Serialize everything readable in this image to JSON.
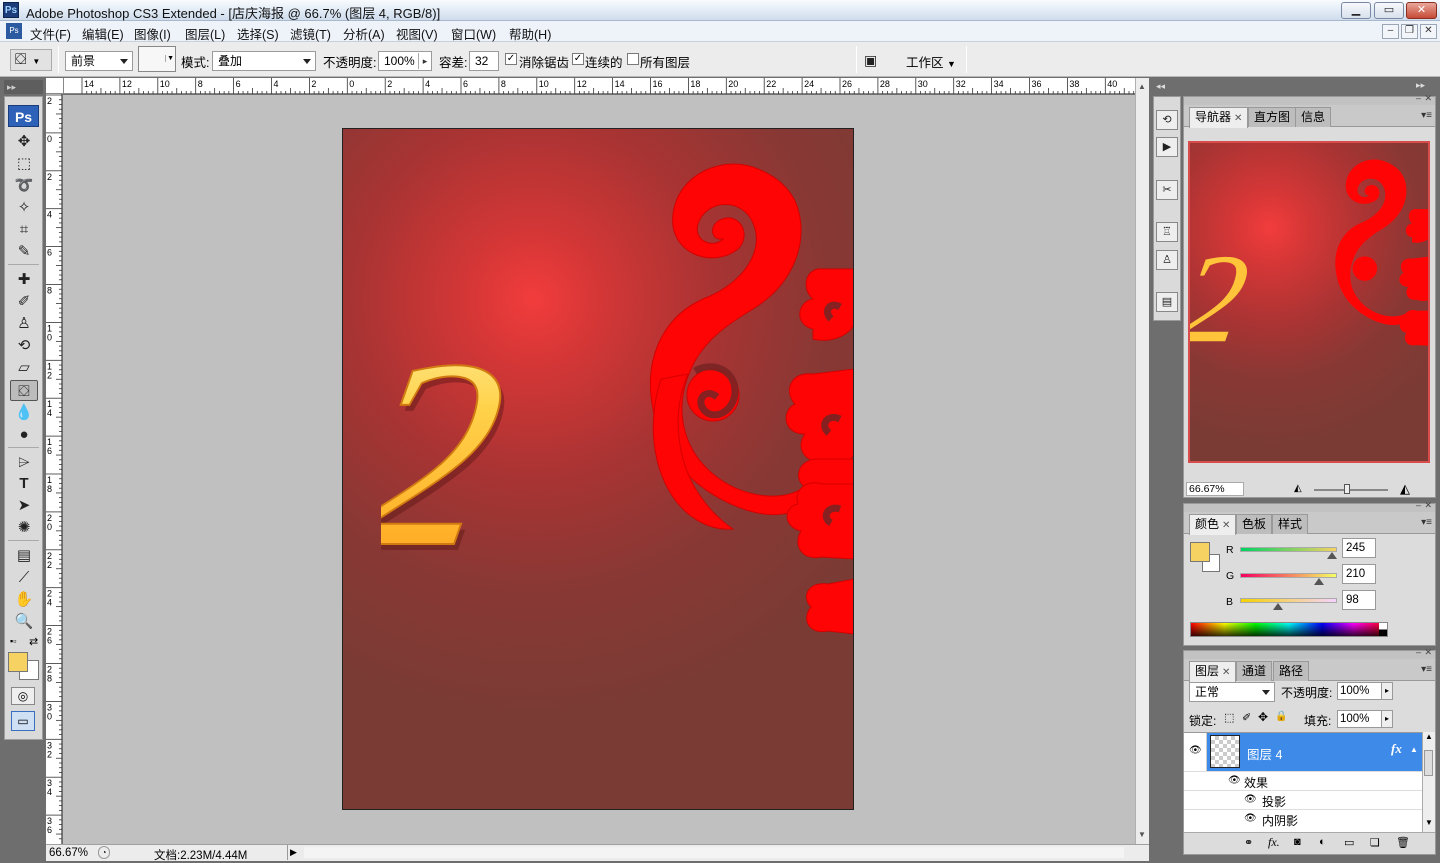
{
  "window": {
    "title": "Adobe Photoshop CS3 Extended - [店庆海报 @ 66.7% (图层 4, RGB/8)]",
    "ps_logo": "Ps",
    "controls": [
      "▁",
      "▭",
      "✕"
    ]
  },
  "menu": {
    "items": [
      "文件(F)",
      "编辑(E)",
      "图像(I)",
      "图层(L)",
      "选择(S)",
      "滤镜(T)",
      "分析(A)",
      "视图(V)",
      "窗口(W)",
      "帮助(H)"
    ],
    "doc_controls": [
      "‒",
      "❐",
      "✕"
    ]
  },
  "options": {
    "fill_source": "前景",
    "mode_label": "模式:",
    "mode_value": "叠加",
    "opacity_label": "不透明度:",
    "opacity_value": "100%",
    "tolerance_label": "容差:",
    "tolerance_value": "32",
    "antialias_label": "消除锯齿",
    "antialias_checked": true,
    "contiguous_label": "连续的",
    "contiguous_checked": true,
    "all_layers_label": "所有图层",
    "all_layers_checked": false,
    "workspace_label": "工作区"
  },
  "ruler": {
    "top_labels": [
      "14",
      "12",
      "10",
      "8",
      "6",
      "4",
      "2",
      "0",
      "2",
      "4",
      "6",
      "8",
      "10",
      "12",
      "14",
      "16",
      "18",
      "20",
      "22",
      "24",
      "26",
      "28",
      "30",
      "32",
      "34",
      "36",
      "38",
      "40"
    ],
    "left_labels": [
      "2",
      "0",
      "2",
      "4",
      "6",
      "8",
      "10",
      "12",
      "14",
      "16",
      "18",
      "20",
      "22",
      "24",
      "26",
      "28",
      "30",
      "32",
      "34",
      "36"
    ]
  },
  "toolbox": {
    "logo": "Ps",
    "foreground_color": "#f5d262",
    "background_color": "#ffffff"
  },
  "document": {
    "numeral": "2"
  },
  "status": {
    "zoom": "66.67%",
    "doc_size": "文档:2.23M/4.44M"
  },
  "navigator": {
    "tabs": [
      "导航器",
      "直方图",
      "信息"
    ],
    "zoom": "66.67%"
  },
  "color_panel": {
    "tabs": [
      "颜色",
      "色板",
      "样式"
    ],
    "r_label": "R",
    "g_label": "G",
    "b_label": "B",
    "r": "245",
    "g": "210",
    "b": "98",
    "swatch": "#f5d262"
  },
  "layers_panel": {
    "tabs": [
      "图层",
      "通道",
      "路径"
    ],
    "blend_mode": "正常",
    "opacity_label": "不透明度:",
    "opacity": "100%",
    "lock_label": "锁定:",
    "fill_label": "填充:",
    "fill": "100%",
    "layer_name": "图层 4",
    "fx": "fx",
    "effects_label": "效果",
    "effects": [
      "投影",
      "内阴影"
    ]
  }
}
